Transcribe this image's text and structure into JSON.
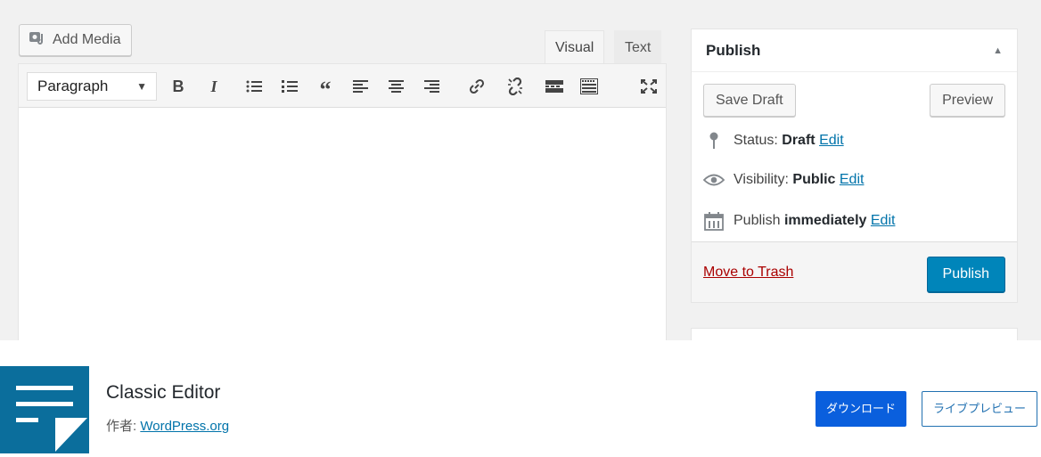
{
  "editor": {
    "add_media_label": "Add Media",
    "tabs": [
      {
        "label": "Visual",
        "active": true
      },
      {
        "label": "Text",
        "active": false
      }
    ],
    "format_select": "Paragraph",
    "toolbar_icons": [
      "bold-icon",
      "italic-icon",
      "bulleted-list-icon",
      "numbered-list-icon",
      "blockquote-icon",
      "align-left-icon",
      "align-center-icon",
      "align-right-icon",
      "insert-link-icon",
      "remove-link-icon",
      "read-more-icon",
      "toolbar-toggle-icon",
      "distraction-free-icon"
    ],
    "bold_glyph": "B",
    "italic_glyph": "I"
  },
  "publish": {
    "title": "Publish",
    "save_draft": "Save Draft",
    "preview": "Preview",
    "status_label": "Status:",
    "status_value": "Draft",
    "visibility_label": "Visibility:",
    "visibility_value": "Public",
    "publish_label": "Publish",
    "publish_value": "immediately",
    "edit_link": "Edit",
    "move_to_trash": "Move to Trash",
    "publish_button": "Publish"
  },
  "plugin": {
    "name": "Classic Editor",
    "author_label": "作者:",
    "author_link": "WordPress.org",
    "download_button": "ダウンロード",
    "live_preview_button": "ライブプレビュー"
  },
  "colors": {
    "primary_button": "#0085ba",
    "link": "#0073aa",
    "trash": "#aa0000",
    "plugin_icon_bg": "#0b6e9c",
    "download_button": "#0a5fdd"
  }
}
